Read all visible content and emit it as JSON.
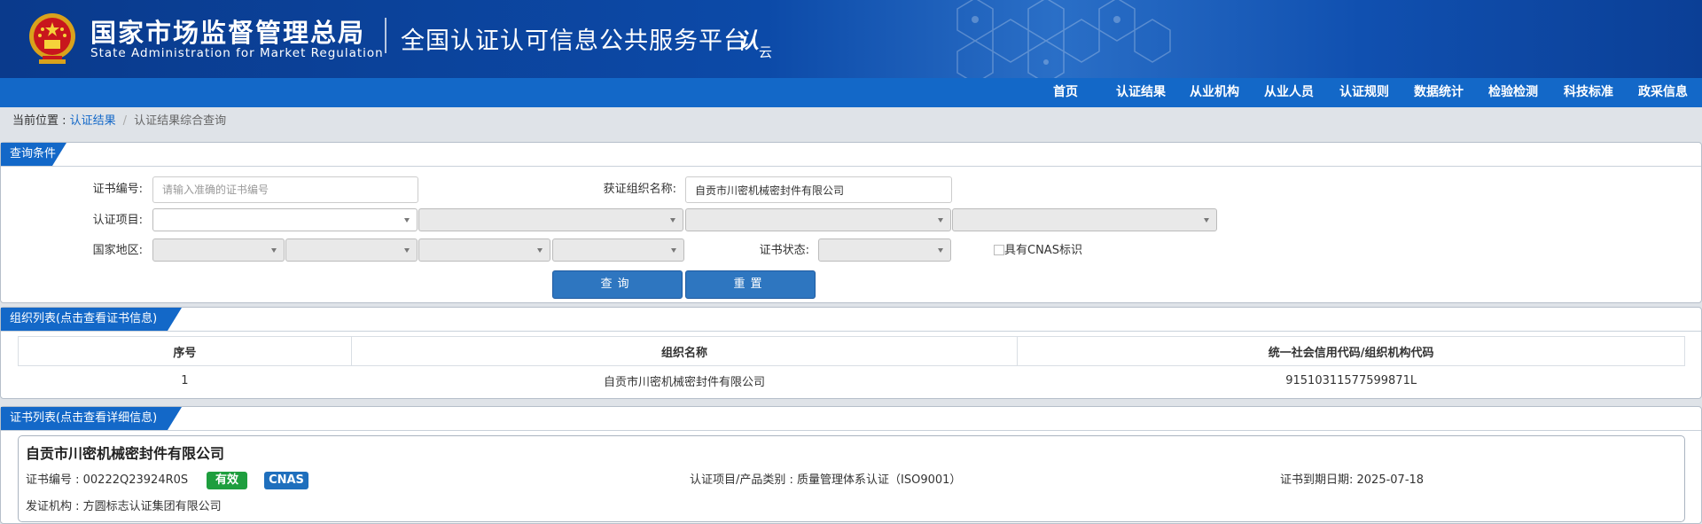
{
  "header": {
    "agency_cn": "国家市场监督管理总局",
    "agency_en": "State Administration  for  Market Regulation",
    "platform": "全国认证认可信息公共服务平台",
    "logo_text": "认",
    "logo_sub": "云",
    "brand_color": "#0c4aa8"
  },
  "nav": [
    "首页",
    "认证结果",
    "从业机构",
    "从业人员",
    "认证规则",
    "数据统计",
    "检验检测",
    "科技标准",
    "政采信息"
  ],
  "breadcrumb": {
    "prefix": "当前位置 : ",
    "link": "认证结果",
    "separator": "/",
    "current": "认证结果综合查询"
  },
  "query": {
    "title": "查询条件",
    "cert_no_label": "证书编号:",
    "cert_no_placeholder": "请输入准确的证书编号",
    "org_label": "获证组织名称:",
    "org_value": "自贡市川密机械密封件有限公司",
    "item_label": "认证项目:",
    "region_label": "国家地区:",
    "status_label": "证书状态:",
    "cnas_label": "具有CNAS标识",
    "search_btn": "查询",
    "reset_btn": "重置"
  },
  "org_list": {
    "title": "组织列表(点击查看证书信息)",
    "columns": [
      "序号",
      "组织名称",
      "统一社会信用代码/组织机构代码"
    ],
    "rows": [
      [
        "1",
        "自贡市川密机械密封件有限公司",
        "91510311577599871L"
      ]
    ]
  },
  "cert_list": {
    "title": "证书列表(点击查看详细信息)",
    "card": {
      "org_name": "自贡市川密机械密封件有限公司",
      "cert_no": "证书编号 : 00222Q23924R0S",
      "status_badge": "有效",
      "cnas_badge": "CNAS",
      "item": "认证项目/产品类别 : 质量管理体系认证（ISO9001）",
      "expiry": "证书到期日期: 2025-07-18",
      "issuer": "发证机构 : 方圆标志认证集团有限公司"
    }
  },
  "colors": {
    "nav_blue": "#1368c8",
    "valid_green": "#1e9e3e",
    "cnas_blue": "#1f6fbd"
  }
}
